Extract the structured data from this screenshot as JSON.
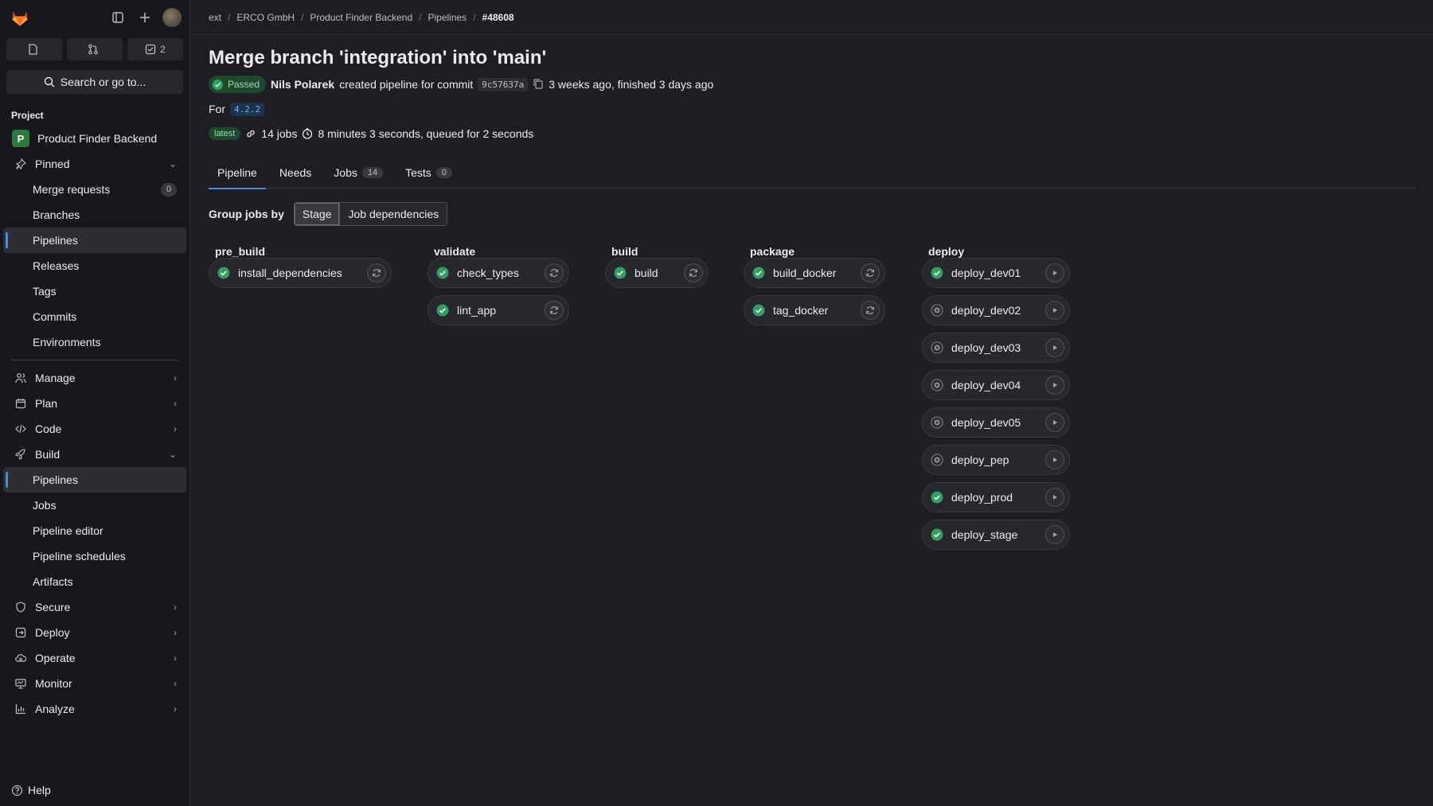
{
  "sidebar": {
    "counters": {
      "issues": "",
      "mrs": "",
      "todos": "2"
    },
    "search_label": "Search or go to...",
    "section_title": "Project",
    "project_initial": "P",
    "project_name": "Product Finder Backend",
    "pinned_label": "Pinned",
    "pinned_items": [
      {
        "label": "Merge requests",
        "badge": "0"
      },
      {
        "label": "Branches"
      },
      {
        "label": "Pipelines"
      },
      {
        "label": "Releases"
      },
      {
        "label": "Tags"
      },
      {
        "label": "Commits"
      },
      {
        "label": "Environments"
      }
    ],
    "groups": [
      {
        "label": "Manage"
      },
      {
        "label": "Plan"
      },
      {
        "label": "Code"
      },
      {
        "label": "Build"
      }
    ],
    "build_items": [
      {
        "label": "Pipelines"
      },
      {
        "label": "Jobs"
      },
      {
        "label": "Pipeline editor"
      },
      {
        "label": "Pipeline schedules"
      },
      {
        "label": "Artifacts"
      }
    ],
    "groups2": [
      {
        "label": "Secure"
      },
      {
        "label": "Deploy"
      },
      {
        "label": "Operate"
      },
      {
        "label": "Monitor"
      },
      {
        "label": "Analyze"
      }
    ],
    "help_label": "Help"
  },
  "breadcrumb": [
    "ext",
    "ERCO GmbH",
    "Product Finder Backend",
    "Pipelines",
    "#48608"
  ],
  "pipeline": {
    "title": "Merge branch 'integration' into 'main'",
    "status": "Passed",
    "author": "Nils Polarek",
    "created_text": "created pipeline for commit",
    "sha": "9c57637a",
    "time_text": "3 weeks ago, finished 3 days ago",
    "for_label": "For",
    "ref": "4.2.2",
    "latest_tag": "latest",
    "jobs_text": "14 jobs",
    "duration_text": "8 minutes 3 seconds, queued for 2 seconds"
  },
  "tabs": [
    {
      "label": "Pipeline",
      "count": ""
    },
    {
      "label": "Needs",
      "count": ""
    },
    {
      "label": "Jobs",
      "count": "14"
    },
    {
      "label": "Tests",
      "count": "0"
    }
  ],
  "group_by": {
    "label": "Group jobs by",
    "options": [
      "Stage",
      "Job dependencies"
    ],
    "selected": "Stage"
  },
  "stages": [
    {
      "name": "pre_build",
      "jobs": [
        {
          "name": "install_dependencies",
          "status": "success",
          "action": "retry"
        }
      ]
    },
    {
      "name": "validate",
      "jobs": [
        {
          "name": "check_types",
          "status": "success",
          "action": "retry"
        },
        {
          "name": "lint_app",
          "status": "success",
          "action": "retry"
        }
      ]
    },
    {
      "name": "build",
      "jobs": [
        {
          "name": "build",
          "status": "success",
          "action": "retry"
        }
      ]
    },
    {
      "name": "package",
      "jobs": [
        {
          "name": "build_docker",
          "status": "success",
          "action": "retry"
        },
        {
          "name": "tag_docker",
          "status": "success",
          "action": "retry"
        }
      ]
    },
    {
      "name": "deploy",
      "jobs": [
        {
          "name": "deploy_dev01",
          "status": "success",
          "action": "play"
        },
        {
          "name": "deploy_dev02",
          "status": "manual",
          "action": "play"
        },
        {
          "name": "deploy_dev03",
          "status": "manual",
          "action": "play"
        },
        {
          "name": "deploy_dev04",
          "status": "manual",
          "action": "play"
        },
        {
          "name": "deploy_dev05",
          "status": "manual",
          "action": "play"
        },
        {
          "name": "deploy_pep",
          "status": "manual",
          "action": "play"
        },
        {
          "name": "deploy_prod",
          "status": "success",
          "action": "play"
        },
        {
          "name": "deploy_stage",
          "status": "success",
          "action": "play"
        }
      ]
    }
  ],
  "colors": {
    "success": "#2da160",
    "accent": "#428fdc",
    "manual": "#737278"
  }
}
